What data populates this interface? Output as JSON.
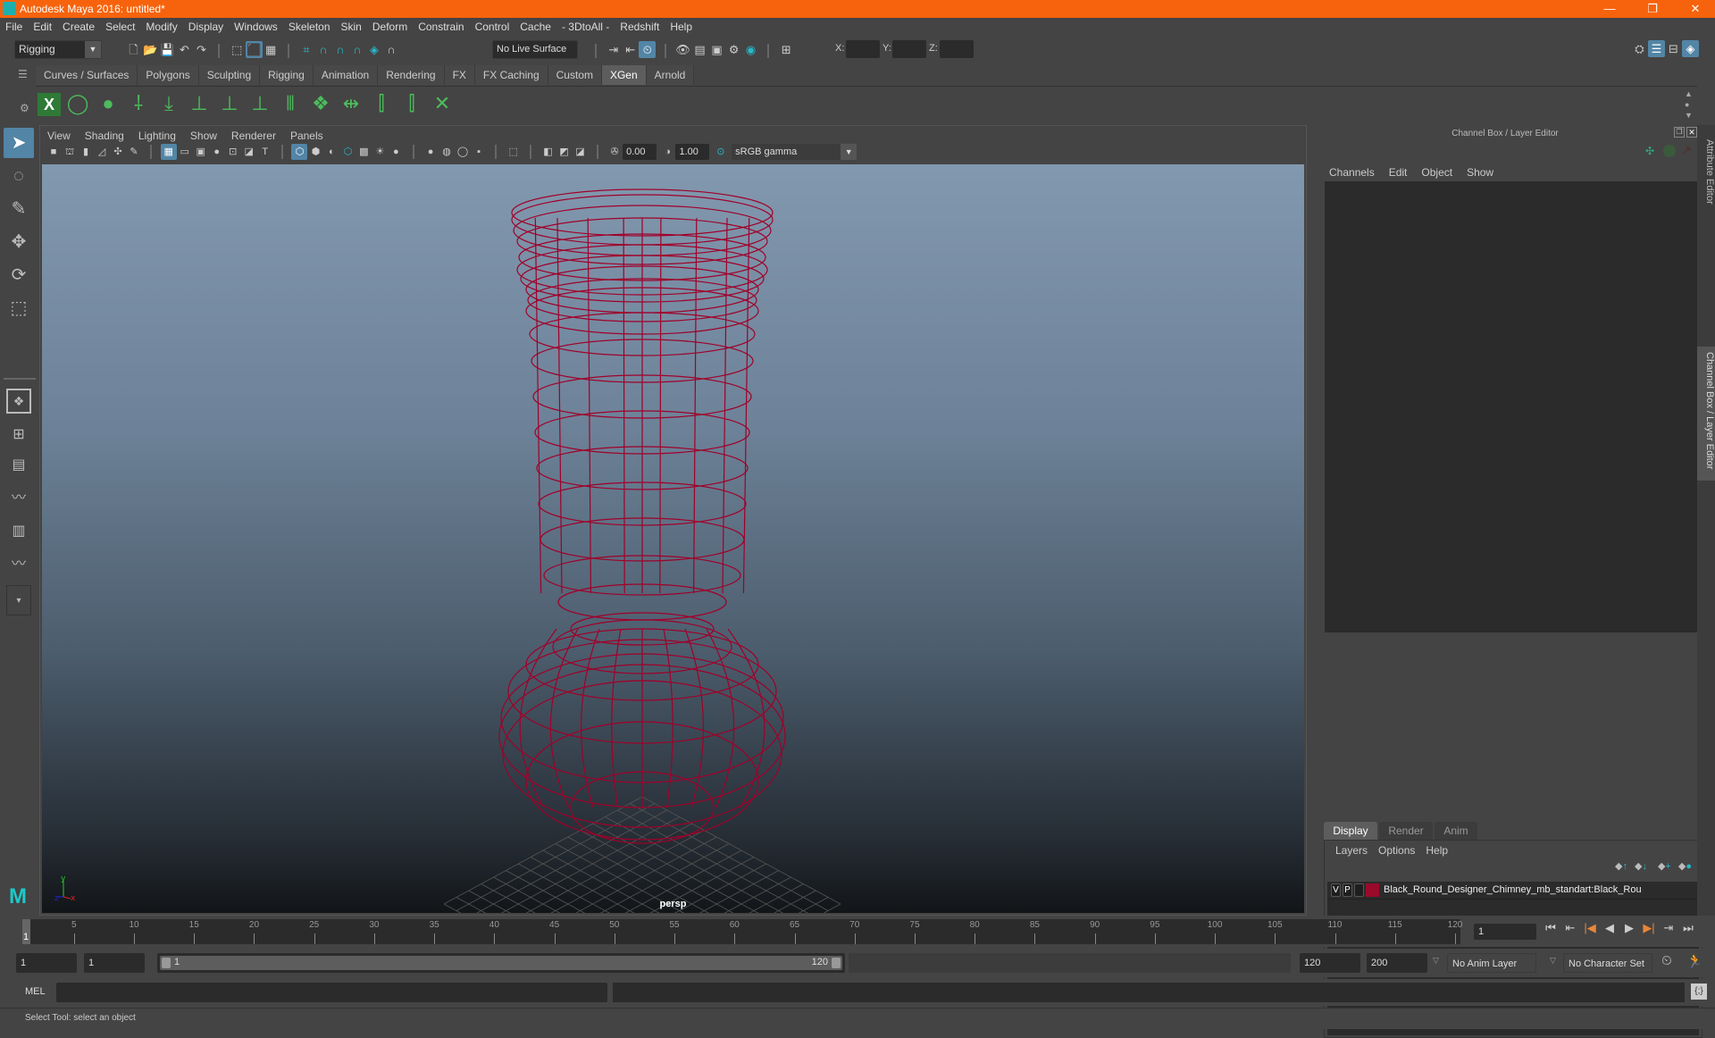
{
  "window": {
    "title": "Autodesk Maya 2016: untitled*",
    "controls": [
      "—",
      "❐",
      "✕"
    ]
  },
  "menubar": [
    "File",
    "Edit",
    "Create",
    "Select",
    "Modify",
    "Display",
    "Windows",
    "Skeleton",
    "Skin",
    "Deform",
    "Constrain",
    "Control",
    "Cache",
    "- 3DtoAll -",
    "Redshift",
    "Help"
  ],
  "statusline": {
    "menuset": "Rigging",
    "live_surface": "No Live Surface",
    "x_label": "X:",
    "y_label": "Y:",
    "z_label": "Z:",
    "x_value": "",
    "y_value": "",
    "z_value": ""
  },
  "shelf": {
    "tabs": [
      "Curves / Surfaces",
      "Polygons",
      "Sculpting",
      "Rigging",
      "Animation",
      "Rendering",
      "FX",
      "FX Caching",
      "Custom",
      "XGen",
      "Arnold"
    ],
    "active_tab": "XGen",
    "icons": [
      "xgen-window-icon",
      "xgen-preview-icon",
      "xgen-hide-icon",
      "xgen-add-guide-icon",
      "xgen-place-icon",
      "xgen-add-spline-icon",
      "xgen-sculpt-icon",
      "xgen-lock-icon",
      "xgen-rebuild-icon",
      "xgen-groom-icon",
      "xgen-flip-icon",
      "xgen-select-icon",
      "xgen-normalize-icon",
      "xgen-delete-icon"
    ]
  },
  "toolbox": [
    "select-tool",
    "lasso-tool",
    "paint-select-tool",
    "move-tool",
    "rotate-tool",
    "scale-tool"
  ],
  "viewport": {
    "menus": [
      "View",
      "Shading",
      "Lighting",
      "Show",
      "Renderer",
      "Panels"
    ],
    "exposure": "0.00",
    "gamma": "1.00",
    "color_space": "sRGB gamma",
    "camera_label": "persp",
    "wire_color": "#a0002a"
  },
  "channelbox": {
    "header": "Channel Box / Layer Editor",
    "menus": [
      "Channels",
      "Edit",
      "Object",
      "Show"
    ],
    "layer_tabs": [
      "Display",
      "Render",
      "Anim"
    ],
    "active_layer_tab": "Display",
    "layer_menus": [
      "Layers",
      "Options",
      "Help"
    ],
    "layers": [
      {
        "v": "V",
        "p": "P",
        "color": "#9a0a2a",
        "name": "Black_Round_Designer_Chimney_mb_standart:Black_Rou"
      }
    ]
  },
  "side_tabs": [
    "Attribute Editor",
    "Channel Box / Layer Editor"
  ],
  "timeline": {
    "start": 1,
    "end": 120,
    "labels": [
      "5",
      "10",
      "15",
      "20",
      "25",
      "30",
      "35",
      "40",
      "45",
      "50",
      "55",
      "60",
      "65",
      "70",
      "75",
      "80",
      "85",
      "90",
      "95",
      "100",
      "105",
      "110",
      "115",
      "120"
    ],
    "current_frame": "1",
    "current_frame_marker": "1"
  },
  "range": {
    "start_field": "1",
    "playback_start": "1",
    "slider_start": "1",
    "slider_end": "120",
    "playback_end": "120",
    "end_field": "200",
    "anim_layer": "No Anim Layer",
    "character_set": "No Character Set"
  },
  "cmdline": {
    "label": "MEL",
    "value": ""
  },
  "helpline": "Select Tool: select an object"
}
